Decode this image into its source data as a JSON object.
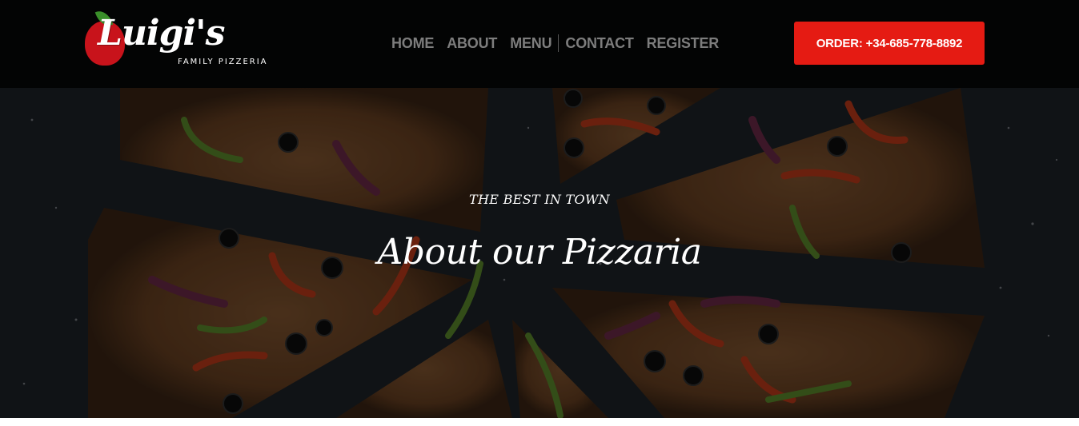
{
  "logo": {
    "name": "Luigi's",
    "tagline": "FAMILY PIZZERIA"
  },
  "nav": {
    "items": [
      "HOME",
      "ABOUT",
      "MENU",
      "CONTACT",
      "REGISTER"
    ]
  },
  "cta": {
    "order_label": "ORDER: +34-685-778-8892"
  },
  "hero": {
    "kicker": "THE BEST IN TOWN",
    "title": "About our Pizzaria",
    "image_icon": "pizza-image"
  },
  "colors": {
    "accent": "#e51b13",
    "nav_text": "#7d7d7d",
    "header_bg": "#000000"
  }
}
